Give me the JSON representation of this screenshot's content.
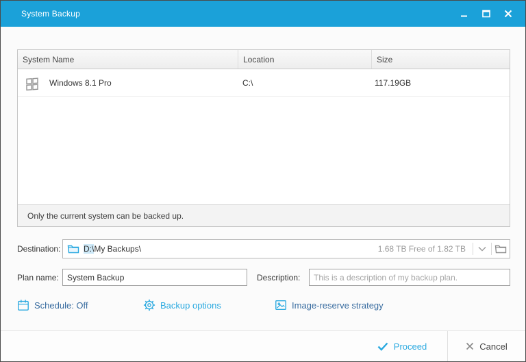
{
  "window": {
    "title": "System Backup"
  },
  "table": {
    "columns": [
      "System Name",
      "Location",
      "Size"
    ],
    "rows": [
      {
        "name": "Windows 8.1 Pro",
        "location": "C:\\",
        "size": "117.19GB"
      }
    ],
    "note": "Only the current system can be backed up."
  },
  "destination": {
    "label": "Destination:",
    "path_selected": "D:\\",
    "path_rest": "My Backups\\",
    "free_space": "1.68 TB Free of 1.82 TB"
  },
  "plan": {
    "label": "Plan name:",
    "value": "System Backup"
  },
  "description": {
    "label": "Description:",
    "placeholder": "This is a description of my backup plan."
  },
  "links": [
    {
      "label": "Schedule: Off",
      "icon": "calendar-icon"
    },
    {
      "label": "Backup options",
      "icon": "gear-icon"
    },
    {
      "label": "Image-reserve strategy",
      "icon": "image-icon"
    }
  ],
  "footer": {
    "proceed": "Proceed",
    "cancel": "Cancel"
  },
  "colors": {
    "titlebar": "#1ba1d9",
    "accent_cyan": "#2aa9e0",
    "link_dark": "#3a6da0",
    "selection": "#cde8f7"
  }
}
